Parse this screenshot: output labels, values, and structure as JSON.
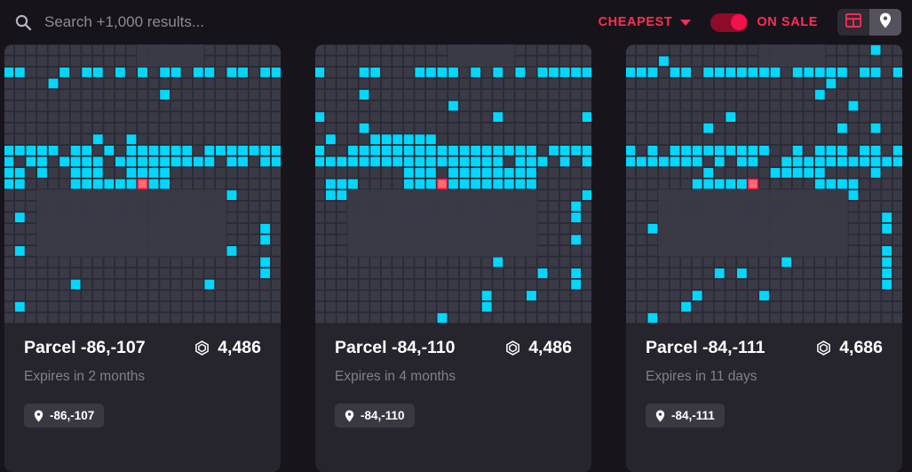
{
  "topbar": {
    "search": {
      "icon": "search-icon",
      "placeholder": "Search +1,000 results...",
      "value": ""
    },
    "sort": {
      "label": "CHEAPEST",
      "icon": "chevron-down-icon"
    },
    "on_sale": {
      "label": "ON SALE",
      "enabled": true
    },
    "view_modes": [
      {
        "name": "grid-view",
        "icon": "grid-icon",
        "active": false
      },
      {
        "name": "map-view",
        "icon": "map-pin-icon",
        "active": true
      }
    ]
  },
  "colors": {
    "accent": "#ff2d55",
    "page_bg": "#17151b",
    "card_bg": "#26242c",
    "map_tile": "#3a3a47",
    "map_gap": "#2a2a35",
    "map_highlight": "#00d8ff",
    "marker": "#ff6b6b",
    "marker_border": "#f5114a"
  },
  "cards": [
    {
      "title": "Parcel -86,-107",
      "price": "4,486",
      "price_icon": "mana-icon",
      "expires": "Expires in 2 months",
      "coords": "-86,-107",
      "coord_icon": "map-pin-icon",
      "map": {
        "marker_col": 12,
        "marker_row": 12,
        "seed": 1
      }
    },
    {
      "title": "Parcel -84,-110",
      "price": "4,486",
      "price_icon": "mana-icon",
      "expires": "Expires in 4 months",
      "coords": "-84,-110",
      "coord_icon": "map-pin-icon",
      "map": {
        "marker_col": 11,
        "marker_row": 12,
        "seed": 2
      }
    },
    {
      "title": "Parcel -84,-111",
      "price": "4,686",
      "price_icon": "mana-icon",
      "expires": "Expires in 11 days",
      "coords": "-84,-111",
      "coord_icon": "map-pin-icon",
      "map": {
        "marker_col": 11,
        "marker_row": 12,
        "seed": 3
      }
    }
  ]
}
